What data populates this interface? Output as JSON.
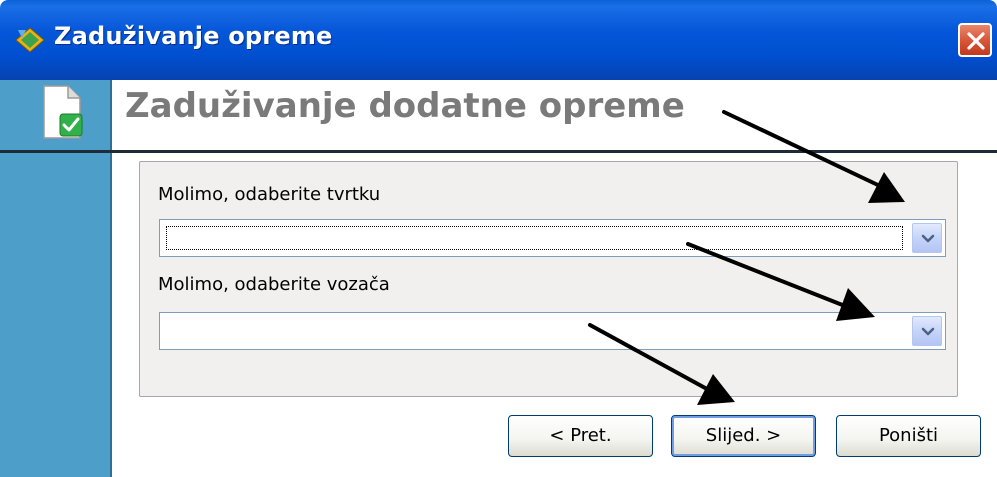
{
  "window": {
    "title": "Zaduživanje opreme"
  },
  "header": {
    "title": "Zaduživanje dodatne opreme"
  },
  "form": {
    "company_label": "Molimo, odaberite tvrtku",
    "company_value": "",
    "driver_label": "Molimo, odaberite vozača",
    "driver_value": ""
  },
  "buttons": {
    "back": "< Pret.",
    "next": "Slijed. >",
    "cancel": "Poništi"
  },
  "icons": {
    "app": "app-diamond-icon",
    "close": "close-x-icon",
    "document": "document-check-icon",
    "dropdown": "chevron-down-icon"
  },
  "colors": {
    "titlebar": "#0556d8",
    "sidebar": "#4d9fc9",
    "close_button": "#d9573a",
    "header_text": "#7a7a7a"
  }
}
